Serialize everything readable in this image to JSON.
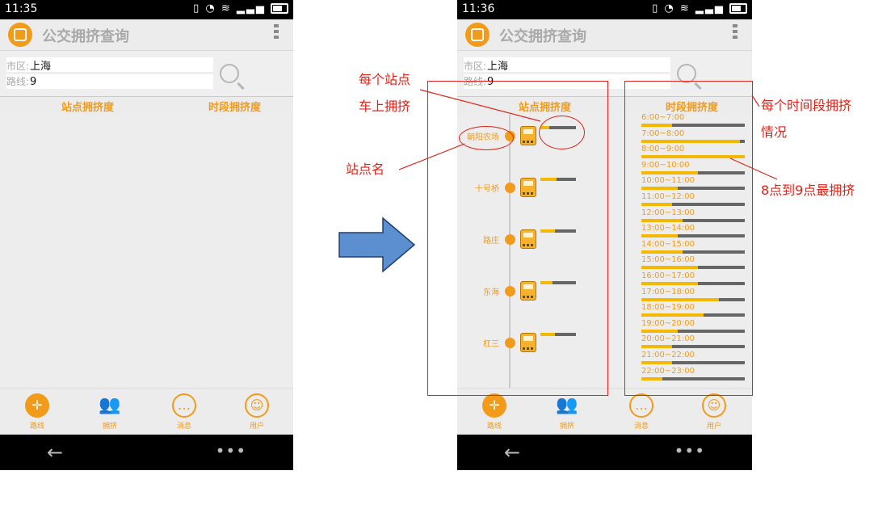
{
  "left_screen": {
    "status": {
      "time": "11:35"
    },
    "app_title": "公交拥挤查询",
    "search": {
      "city_label": "市区:",
      "city_value": "上海",
      "route_label": "路线:",
      "route_value": "9"
    },
    "tabs": [
      "站点拥挤度",
      "时段拥挤度"
    ],
    "nav": [
      "路线",
      "拥挤",
      "消息",
      "用户"
    ]
  },
  "right_screen": {
    "status": {
      "time": "11:36"
    },
    "app_title": "公交拥挤查询",
    "search": {
      "city_label": "市区:",
      "city_value": "上海",
      "route_label": "路线:",
      "route_value": "9"
    },
    "tabs": [
      "站点拥挤度",
      "时段拥挤度"
    ],
    "stations": [
      {
        "name": "朝阳农场",
        "crowding": 0.25
      },
      {
        "name": "十号桥",
        "crowding": 0.45
      },
      {
        "name": "路庄",
        "crowding": 0.4
      },
      {
        "name": "东海",
        "crowding": 0.35
      },
      {
        "name": "杠三",
        "crowding": 0.4
      }
    ],
    "time_slots": [
      {
        "label": "6:00~7:00",
        "crowding": 0.3
      },
      {
        "label": "7:00~8:00",
        "crowding": 0.95
      },
      {
        "label": "8:00~9:00",
        "crowding": 1.0
      },
      {
        "label": "9:00~10:00",
        "crowding": 0.55
      },
      {
        "label": "10:00~11:00",
        "crowding": 0.35
      },
      {
        "label": "11:00~12:00",
        "crowding": 0.3
      },
      {
        "label": "12:00~13:00",
        "crowding": 0.4
      },
      {
        "label": "13:00~14:00",
        "crowding": 0.35
      },
      {
        "label": "14:00~15:00",
        "crowding": 0.4
      },
      {
        "label": "15:00~16:00",
        "crowding": 0.55
      },
      {
        "label": "16:00~17:00",
        "crowding": 0.55
      },
      {
        "label": "17:00~18:00",
        "crowding": 0.75
      },
      {
        "label": "18:00~19:00",
        "crowding": 0.6
      },
      {
        "label": "19:00~20:00",
        "crowding": 0.35
      },
      {
        "label": "20:00~21:00",
        "crowding": 0.3
      },
      {
        "label": "21:00~22:00",
        "crowding": 0.3
      },
      {
        "label": "22:00~23:00",
        "crowding": 0.2
      }
    ],
    "nav": [
      "路线",
      "拥挤",
      "消息",
      "用户"
    ]
  },
  "annotations": {
    "station_crowding_line1": "每个站点",
    "station_crowding_line2": "车上拥挤",
    "station_name": "站点名",
    "time_crowding_line1": "每个时间段拥挤",
    "time_crowding_line2": "情况",
    "peak_note": "8点到9点最拥挤"
  },
  "colors": {
    "accent": "#f29b1b",
    "bar_fill": "#f5b800",
    "bar_track": "#666666",
    "annotation_red": "#e2231a",
    "arrow_blue": "#5b8fd0"
  }
}
